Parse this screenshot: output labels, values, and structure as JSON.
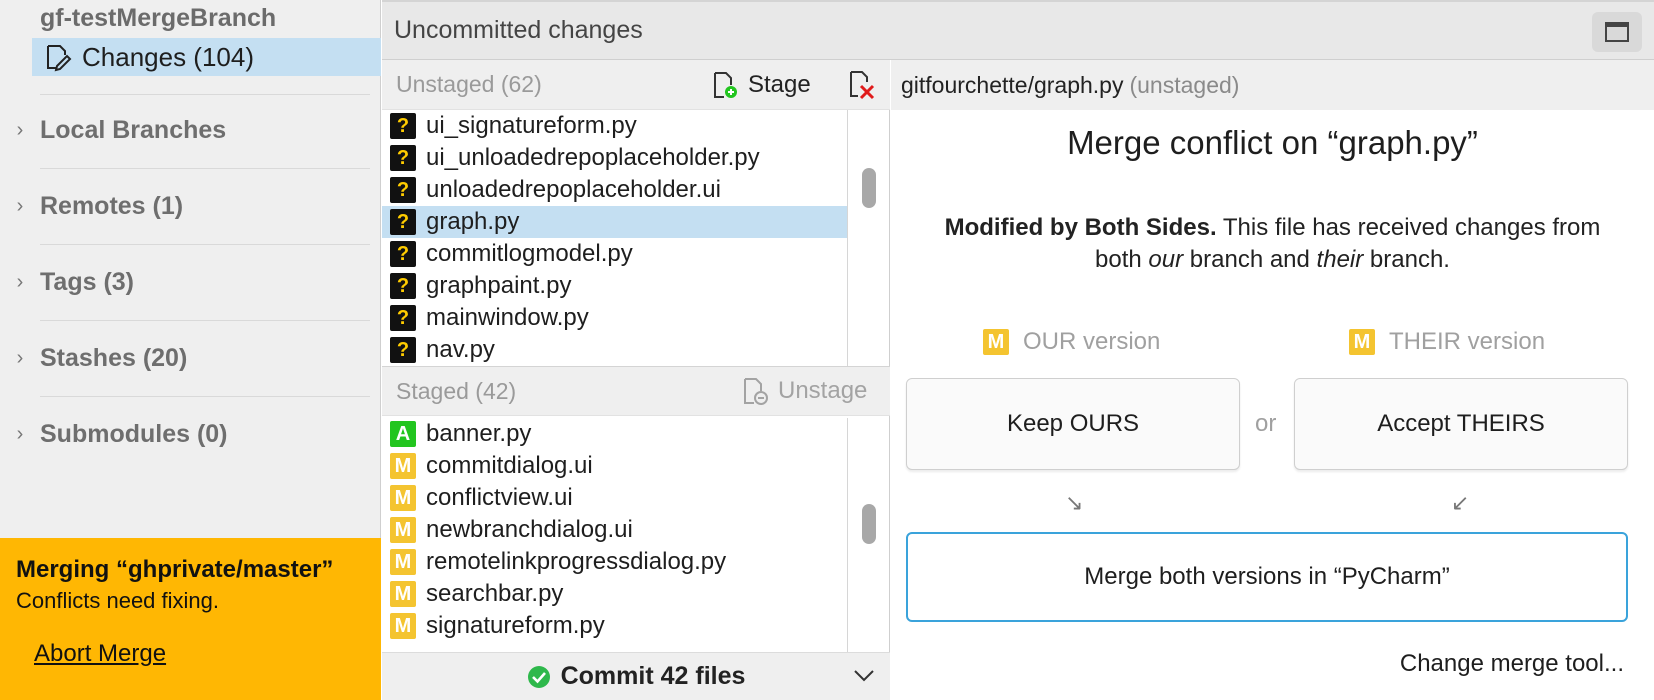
{
  "sidebar": {
    "repo_name": "gf-testMergeBranch",
    "changes_label": "Changes (104)",
    "sections": [
      {
        "label": "Local Branches"
      },
      {
        "label": "Remotes (1)"
      },
      {
        "label": "Tags (3)"
      },
      {
        "label": "Stashes (20)"
      },
      {
        "label": "Submodules (0)"
      }
    ],
    "merge_banner": {
      "title": "Merging “ghprivate/master”",
      "subtitle": "Conflicts need fixing.",
      "abort_label": "Abort Merge"
    }
  },
  "header": {
    "title": "Uncommitted changes"
  },
  "unstaged": {
    "title": "Unstaged (62)",
    "action_label": "Stage",
    "files": [
      {
        "status": "?",
        "name": "ui_signatureform.py"
      },
      {
        "status": "?",
        "name": "ui_unloadedrepoplaceholder.py"
      },
      {
        "status": "?",
        "name": "unloadedrepoplaceholder.ui"
      },
      {
        "status": "?",
        "name": "graph.py",
        "selected": true
      },
      {
        "status": "?",
        "name": "commitlogmodel.py"
      },
      {
        "status": "?",
        "name": "graphpaint.py"
      },
      {
        "status": "?",
        "name": "mainwindow.py"
      },
      {
        "status": "?",
        "name": "nav.py"
      }
    ]
  },
  "staged": {
    "title": "Staged (42)",
    "action_label": "Unstage",
    "files": [
      {
        "status": "A",
        "name": "banner.py"
      },
      {
        "status": "M",
        "name": "commitdialog.ui"
      },
      {
        "status": "M",
        "name": "conflictview.ui"
      },
      {
        "status": "M",
        "name": "newbranchdialog.ui"
      },
      {
        "status": "M",
        "name": "remotelinkprogressdialog.py"
      },
      {
        "status": "M",
        "name": "searchbar.py"
      },
      {
        "status": "M",
        "name": "signatureform.py"
      }
    ]
  },
  "commit": {
    "label": "Commit 42 files"
  },
  "conflict": {
    "path": "gitfourchette/graph.py",
    "status": "(unstaged)",
    "title": "Merge conflict on “graph.py”",
    "desc_bold": "Modified by Both Sides.",
    "desc_1": " This file has received changes from both ",
    "desc_our": "our",
    "desc_2": " branch and ",
    "desc_their": "their",
    "desc_3": " branch.",
    "our_badge": "M",
    "our_label": "OUR version",
    "their_badge": "M",
    "their_label": "THEIR version",
    "keep_ours": "Keep OURS",
    "or": "or",
    "accept_theirs": "Accept THEIRS",
    "arrow_left": "↘",
    "arrow_right": "↙",
    "merge_both": "Merge both versions in “PyCharm”",
    "change_tool": "Change merge tool..."
  },
  "colors": {
    "accent_selected": "#c4dff2",
    "merge_banner": "#ffb703",
    "badge_added": "#22c51f",
    "badge_modified": "#f4c430",
    "badge_unknown": "#111111",
    "focus_border": "#3aa3db"
  }
}
